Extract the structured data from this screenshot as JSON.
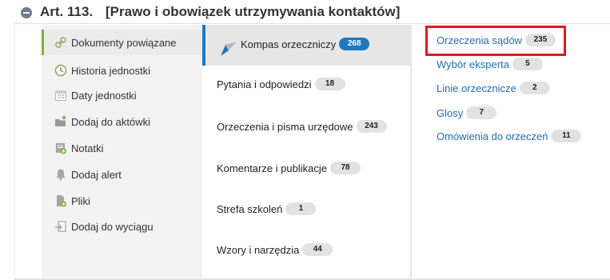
{
  "header": {
    "article_number": "Art.  113.",
    "article_title": "[Prawo i obowiązek utrzymywania kontaktów]"
  },
  "sidebar": {
    "items": [
      {
        "label": "Dokumenty powiązane",
        "icon": "link-icon",
        "active": true
      },
      {
        "label": "Historia jednostki",
        "icon": "clock-icon"
      },
      {
        "label": "Daty jednostki",
        "icon": "calendar-icon"
      },
      {
        "label": "Dodaj do aktówki",
        "icon": "folder-add-icon"
      },
      {
        "label": "Notatki",
        "icon": "note-add-icon"
      },
      {
        "label": "Dodaj alert",
        "icon": "bell-icon"
      },
      {
        "label": "Pliki",
        "icon": "file-add-icon"
      },
      {
        "label": "Dodaj do wyciągu",
        "icon": "export-icon"
      }
    ]
  },
  "categories": {
    "items": [
      {
        "label": "Kompas orzeczniczy",
        "count": "268",
        "active": true
      },
      {
        "label": "Pytania i odpowiedzi",
        "count": "18"
      },
      {
        "label": "Orzeczenia i pisma urzędowe",
        "count": "243"
      },
      {
        "label": "Komentarze i publikacje",
        "count": "78"
      },
      {
        "label": "Strefa szkoleń",
        "count": "1"
      },
      {
        "label": "Wzory i narzędzia",
        "count": "44"
      }
    ]
  },
  "subcategories": {
    "items": [
      {
        "label": "Orzeczenia sądów",
        "count": "235",
        "highlighted": true
      },
      {
        "label": "Wybór eksperta",
        "count": "5"
      },
      {
        "label": "Linie orzecznicze",
        "count": "2"
      },
      {
        "label": "Glosy",
        "count": "7"
      },
      {
        "label": "Omówienia do orzeczeń",
        "count": "11"
      }
    ]
  },
  "colors": {
    "accent_green": "#7bb537",
    "accent_blue": "#1e78c2",
    "link_blue": "#1e6fb3",
    "highlight_red": "#e8151d"
  }
}
